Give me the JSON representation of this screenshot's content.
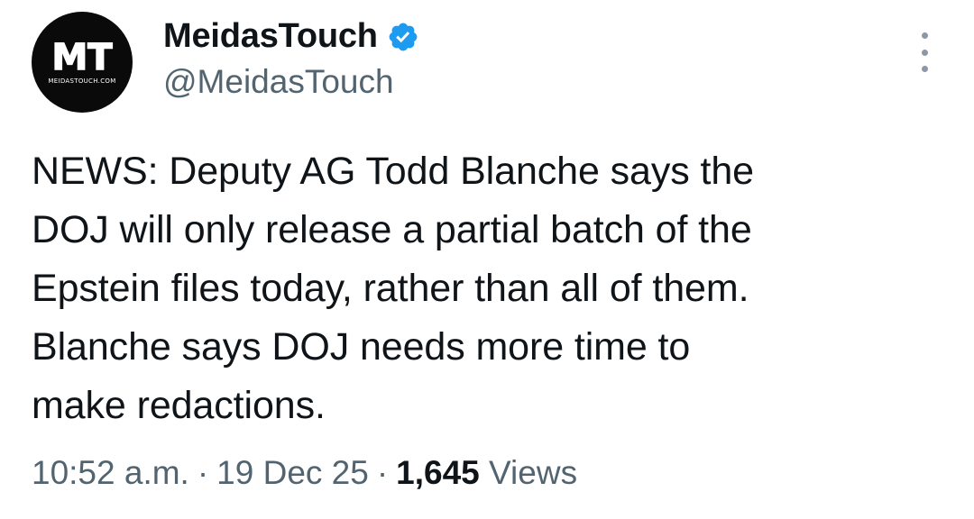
{
  "author": {
    "avatar_logo_text": "MT",
    "avatar_sub_text": "MEIDASTOUCH.COM",
    "display_name": "MeidasTouch",
    "handle": "@MeidasTouch",
    "verified_icon": "verified-badge-icon",
    "verified_color": "#1d9bf0"
  },
  "menu": {
    "icon": "more-vertical-icon"
  },
  "tweet": {
    "text": "NEWS: Deputy AG Todd Blanche says the\nDOJ will only release a partial batch of the\nEpstein files today, rather than all of them.\nBlanche says DOJ needs more time to\nmake redactions."
  },
  "meta": {
    "time": "10:52 a.m.",
    "separator": "·",
    "date": "19 Dec 25",
    "views_count": "1,645",
    "views_label": "Views"
  }
}
